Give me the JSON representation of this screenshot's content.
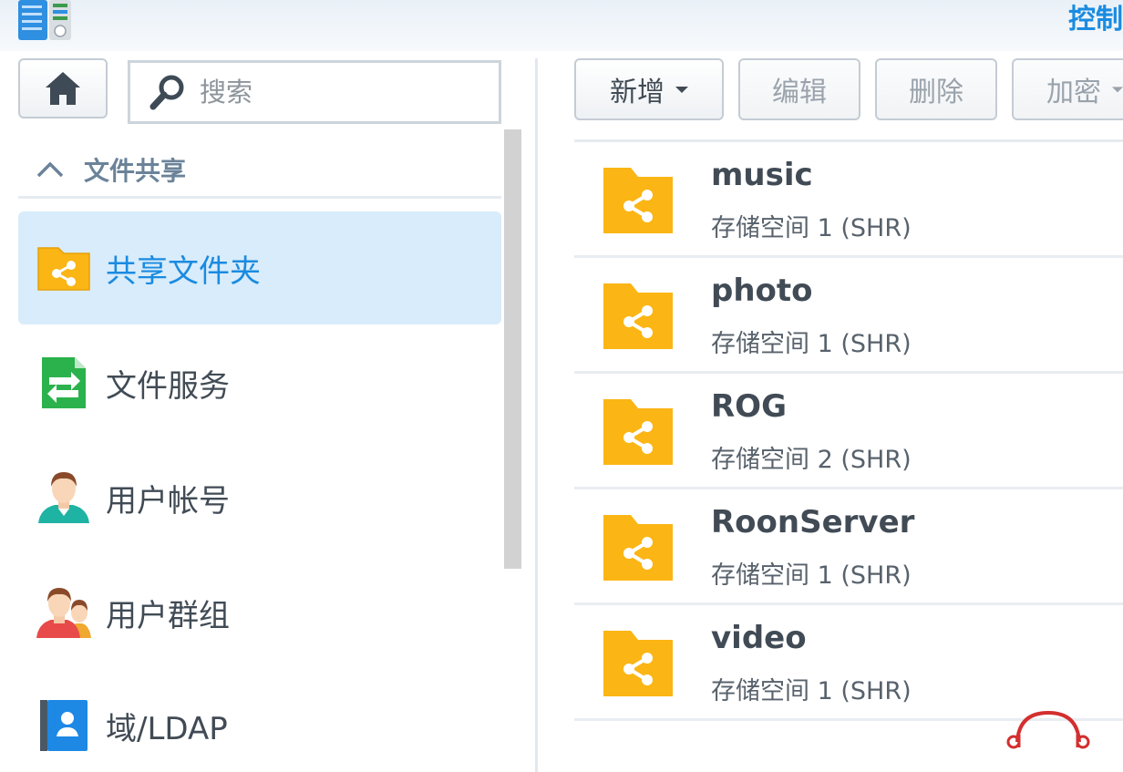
{
  "window": {
    "title": "控制"
  },
  "sidebar": {
    "search_placeholder": "搜索",
    "section_label": "文件共享",
    "items": [
      {
        "label": "共享文件夹",
        "icon": "shared-folder-icon",
        "active": true
      },
      {
        "label": "文件服务",
        "icon": "file-services-icon",
        "active": false
      },
      {
        "label": "用户帐号",
        "icon": "user-icon",
        "active": false
      },
      {
        "label": "用户群组",
        "icon": "group-icon",
        "active": false
      },
      {
        "label": "域/LDAP",
        "icon": "ldap-icon",
        "active": false
      }
    ]
  },
  "toolbar": {
    "add_label": "新增",
    "edit_label": "编辑",
    "delete_label": "删除",
    "encrypt_label": "加密"
  },
  "shared_folders": [
    {
      "name": "music",
      "volume": "存储空间 1 (SHR)"
    },
    {
      "name": "photo",
      "volume": "存储空间 1 (SHR)"
    },
    {
      "name": "ROG",
      "volume": "存储空间 2 (SHR)"
    },
    {
      "name": "RoonServer",
      "volume": "存储空间 1 (SHR)"
    },
    {
      "name": "video",
      "volume": "存储空间 1 (SHR)"
    }
  ],
  "colors": {
    "accent": "#1a8be0",
    "folder": "#fbb514",
    "active_bg": "#d8ecfb",
    "file_services": "#2bb24c",
    "ldap": "#1e88e5",
    "watermark": "#d32f2f"
  }
}
